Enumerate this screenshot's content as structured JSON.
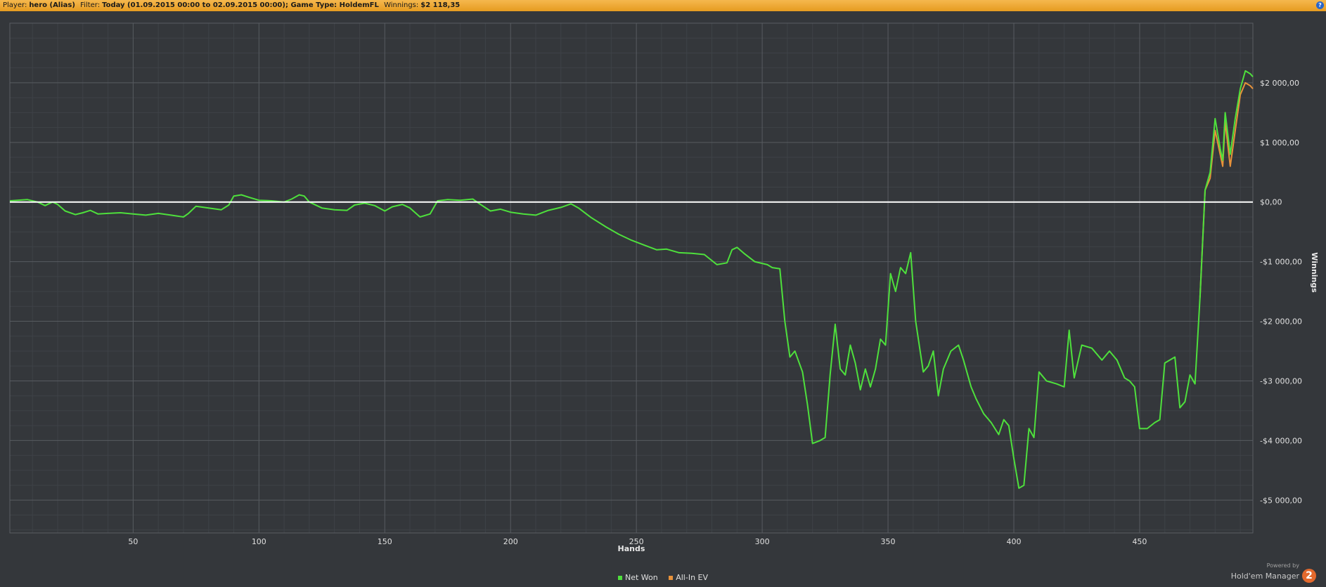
{
  "header": {
    "player_label": "Player:",
    "player_value": "hero (Alias)",
    "filter_label": "Filter:",
    "filter_value": "Today (01.09.2015 00:00 to 02.09.2015 00:00); Game Type: HoldemFL",
    "winnings_label": "Winnings:",
    "winnings_value": "$2 118,35",
    "help_icon": "?"
  },
  "chart_data": {
    "type": "line",
    "xlabel": "Hands",
    "ylabel": "Winnings",
    "xlim": [
      1,
      495
    ],
    "ylim": [
      -5550,
      3000
    ],
    "x_ticks": [
      50,
      100,
      150,
      200,
      250,
      300,
      350,
      400,
      450
    ],
    "y_ticks": [
      {
        "value": 2000,
        "label": "$2 000,00"
      },
      {
        "value": 1000,
        "label": "$1 000,00"
      },
      {
        "value": 0,
        "label": "$0,00"
      },
      {
        "value": -1000,
        "label": "-$1 000,00"
      },
      {
        "value": -2000,
        "label": "-$2 000,00"
      },
      {
        "value": -3000,
        "label": "-$3 000,00"
      },
      {
        "value": -4000,
        "label": "-$4 000,00"
      },
      {
        "value": -5000,
        "label": "-$5 000,00"
      }
    ],
    "grid": true,
    "legend_position": "bottom-center",
    "series": [
      {
        "name": "Net Won",
        "color": "#4ee03c",
        "points": [
          [
            1,
            20
          ],
          [
            8,
            40
          ],
          [
            12,
            0
          ],
          [
            15,
            -60
          ],
          [
            18,
            0
          ],
          [
            20,
            -40
          ],
          [
            23,
            -150
          ],
          [
            27,
            -210
          ],
          [
            30,
            -180
          ],
          [
            33,
            -140
          ],
          [
            36,
            -200
          ],
          [
            40,
            -190
          ],
          [
            45,
            -180
          ],
          [
            50,
            -200
          ],
          [
            55,
            -220
          ],
          [
            60,
            -190
          ],
          [
            65,
            -220
          ],
          [
            70,
            -250
          ],
          [
            72,
            -190
          ],
          [
            75,
            -70
          ],
          [
            80,
            -100
          ],
          [
            85,
            -130
          ],
          [
            88,
            -50
          ],
          [
            90,
            100
          ],
          [
            93,
            120
          ],
          [
            96,
            80
          ],
          [
            100,
            30
          ],
          [
            105,
            20
          ],
          [
            110,
            0
          ],
          [
            113,
            50
          ],
          [
            116,
            120
          ],
          [
            118,
            100
          ],
          [
            120,
            0
          ],
          [
            125,
            -100
          ],
          [
            130,
            -130
          ],
          [
            135,
            -140
          ],
          [
            138,
            -50
          ],
          [
            142,
            -20
          ],
          [
            146,
            -60
          ],
          [
            150,
            -150
          ],
          [
            153,
            -80
          ],
          [
            157,
            -40
          ],
          [
            160,
            -100
          ],
          [
            164,
            -250
          ],
          [
            168,
            -200
          ],
          [
            171,
            20
          ],
          [
            175,
            40
          ],
          [
            180,
            30
          ],
          [
            185,
            50
          ],
          [
            188,
            -40
          ],
          [
            192,
            -150
          ],
          [
            196,
            -120
          ],
          [
            200,
            -170
          ],
          [
            205,
            -200
          ],
          [
            210,
            -220
          ],
          [
            215,
            -140
          ],
          [
            220,
            -90
          ],
          [
            224,
            -30
          ],
          [
            227,
            -100
          ],
          [
            232,
            -260
          ],
          [
            238,
            -420
          ],
          [
            243,
            -540
          ],
          [
            248,
            -640
          ],
          [
            253,
            -720
          ],
          [
            258,
            -800
          ],
          [
            262,
            -790
          ],
          [
            267,
            -850
          ],
          [
            272,
            -860
          ],
          [
            277,
            -880
          ],
          [
            282,
            -1050
          ],
          [
            286,
            -1020
          ],
          [
            288,
            -800
          ],
          [
            290,
            -760
          ],
          [
            293,
            -870
          ],
          [
            297,
            -1000
          ],
          [
            302,
            -1050
          ],
          [
            304,
            -1100
          ],
          [
            307,
            -1120
          ],
          [
            309,
            -2000
          ],
          [
            311,
            -2600
          ],
          [
            313,
            -2500
          ],
          [
            316,
            -2850
          ],
          [
            318,
            -3400
          ],
          [
            320,
            -4050
          ],
          [
            323,
            -4000
          ],
          [
            325,
            -3950
          ],
          [
            327,
            -2900
          ],
          [
            329,
            -2050
          ],
          [
            331,
            -2800
          ],
          [
            333,
            -2900
          ],
          [
            335,
            -2400
          ],
          [
            337,
            -2700
          ],
          [
            339,
            -3150
          ],
          [
            341,
            -2800
          ],
          [
            343,
            -3100
          ],
          [
            345,
            -2800
          ],
          [
            347,
            -2300
          ],
          [
            349,
            -2400
          ],
          [
            351,
            -1200
          ],
          [
            353,
            -1500
          ],
          [
            355,
            -1100
          ],
          [
            357,
            -1200
          ],
          [
            359,
            -850
          ],
          [
            361,
            -2000
          ],
          [
            364,
            -2850
          ],
          [
            366,
            -2750
          ],
          [
            368,
            -2500
          ],
          [
            370,
            -3250
          ],
          [
            372,
            -2800
          ],
          [
            375,
            -2500
          ],
          [
            378,
            -2400
          ],
          [
            380,
            -2650
          ],
          [
            383,
            -3100
          ],
          [
            385,
            -3300
          ],
          [
            388,
            -3550
          ],
          [
            391,
            -3700
          ],
          [
            394,
            -3900
          ],
          [
            396,
            -3650
          ],
          [
            398,
            -3750
          ],
          [
            400,
            -4300
          ],
          [
            402,
            -4800
          ],
          [
            404,
            -4750
          ],
          [
            406,
            -3800
          ],
          [
            408,
            -3950
          ],
          [
            410,
            -2850
          ],
          [
            413,
            -3000
          ],
          [
            417,
            -3050
          ],
          [
            420,
            -3100
          ],
          [
            422,
            -2150
          ],
          [
            424,
            -2950
          ],
          [
            427,
            -2400
          ],
          [
            431,
            -2450
          ],
          [
            435,
            -2650
          ],
          [
            438,
            -2500
          ],
          [
            441,
            -2650
          ],
          [
            444,
            -2950
          ],
          [
            446,
            -3000
          ],
          [
            448,
            -3100
          ],
          [
            450,
            -3800
          ],
          [
            453,
            -3800
          ],
          [
            456,
            -3700
          ],
          [
            458,
            -3650
          ],
          [
            460,
            -2700
          ],
          [
            464,
            -2600
          ],
          [
            466,
            -3450
          ],
          [
            468,
            -3350
          ],
          [
            470,
            -2900
          ],
          [
            472,
            -3050
          ],
          [
            474,
            -1600
          ],
          [
            476,
            200
          ],
          [
            478,
            500
          ],
          [
            480,
            1400
          ],
          [
            482,
            900
          ],
          [
            483,
            700
          ],
          [
            484,
            1500
          ],
          [
            486,
            800
          ],
          [
            488,
            1400
          ],
          [
            490,
            1900
          ],
          [
            492,
            2200
          ],
          [
            494,
            2150
          ],
          [
            495,
            2100
          ]
        ]
      },
      {
        "name": "All-In EV",
        "color": "#e8923a",
        "points": [
          [
            474,
            -1600
          ],
          [
            476,
            200
          ],
          [
            478,
            400
          ],
          [
            480,
            1200
          ],
          [
            482,
            800
          ],
          [
            483,
            600
          ],
          [
            484,
            1350
          ],
          [
            486,
            600
          ],
          [
            488,
            1200
          ],
          [
            490,
            1800
          ],
          [
            492,
            2000
          ],
          [
            494,
            1950
          ],
          [
            495,
            1900
          ]
        ]
      }
    ]
  },
  "branding": {
    "powered_by": "Powered by",
    "name": "Hold'em Manager",
    "badge": "2"
  }
}
